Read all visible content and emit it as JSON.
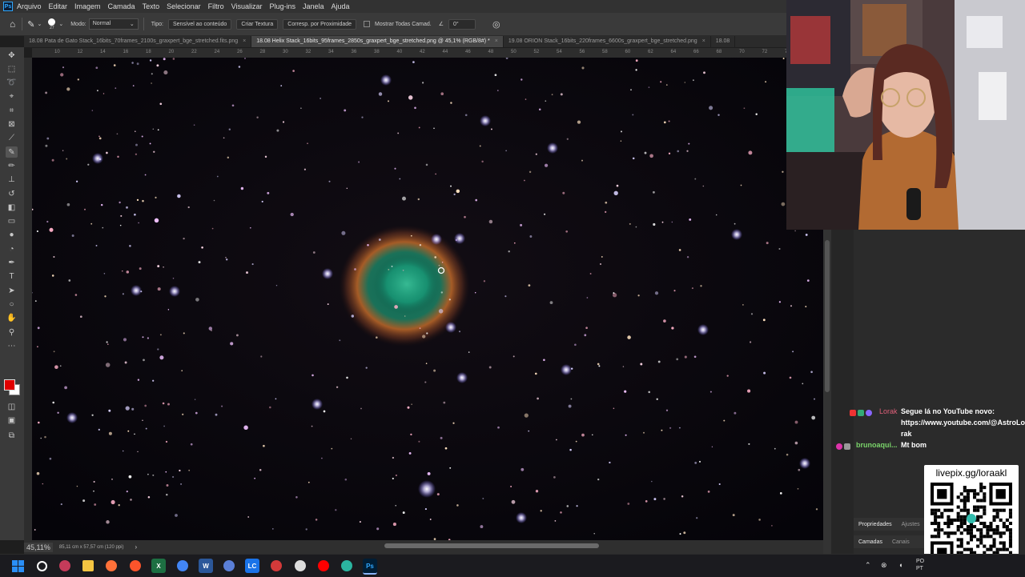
{
  "menubar": {
    "logo": "Ps",
    "items": [
      "Arquivo",
      "Editar",
      "Imagem",
      "Camada",
      "Texto",
      "Selecionar",
      "Filtro",
      "Visualizar",
      "Plug-ins",
      "Janela",
      "Ajuda"
    ]
  },
  "options": {
    "brush_size": "27",
    "mode_label": "Modo:",
    "mode_value": "Normal",
    "type_label": "Tipo:",
    "type_buttons": [
      "Sensível ao conteúdo",
      "Criar Textura",
      "Corresp. por Proximidade"
    ],
    "sample_all_label": "Mostrar Todas Camad.",
    "angle_value": "0°"
  },
  "tabs": [
    {
      "label": "18.08 Pata de Gato Stack_16bits_70frames_2100s_graxpert_bge_stretched.fits.png",
      "active": false
    },
    {
      "label": "18.08 Helix Stack_16bits_95frames_2850s_graxpert_bge_stretched.png @ 45,1% (RGB/8#) *",
      "active": true
    },
    {
      "label": "19.08 ORION Stack_16bits_220frames_6600s_graxpert_bge_stretched.png",
      "active": false
    },
    {
      "label": "18.08",
      "active": false
    }
  ],
  "ruler": {
    "ticks": [
      "10",
      "12",
      "14",
      "16",
      "18",
      "20",
      "22",
      "24",
      "26",
      "28",
      "30",
      "32",
      "34",
      "36",
      "38",
      "40",
      "42",
      "44",
      "46",
      "48",
      "50",
      "52",
      "54",
      "56",
      "58",
      "60",
      "62",
      "64",
      "66",
      "68",
      "70",
      "72",
      "74"
    ]
  },
  "status": {
    "zoom": "45,11%",
    "doc_info": "85,11 cm x 57,57 cm (120 ppi)",
    "arrow": "›"
  },
  "chat": [
    {
      "user": "Lorak",
      "message": "Segue lá no YouTube novo: https://www.youtube.com/@AstroLo rak",
      "user_color": "#e0607a"
    },
    {
      "user": "brunoaqui...",
      "message": "Mt bom",
      "user_color": "#7ad36a"
    }
  ],
  "panels": {
    "tabs1": [
      "Propriedades",
      "Ajustes"
    ],
    "tabs2": [
      "Camadas",
      "Canais"
    ]
  },
  "qr": {
    "label": "livepix.gg/loraakl"
  },
  "taskbar": {
    "apps": [
      {
        "name": "windows-start-icon",
        "glyph": "",
        "color": "#2a8ff7"
      },
      {
        "name": "search-icon",
        "glyph": "",
        "color": "#ffffff"
      },
      {
        "name": "task-view-icon",
        "glyph": "",
        "color": "#c43b5a"
      },
      {
        "name": "file-explorer-icon",
        "glyph": "",
        "color": "#f4c542"
      },
      {
        "name": "firefox-icon",
        "glyph": "",
        "color": "#ff7139"
      },
      {
        "name": "brave-icon",
        "glyph": "",
        "color": "#fb542b"
      },
      {
        "name": "excel-icon",
        "glyph": "X",
        "color": "#1d6f42"
      },
      {
        "name": "chrome-icon",
        "glyph": "",
        "color": "#4285f4"
      },
      {
        "name": "word-icon",
        "glyph": "W",
        "color": "#2b579a"
      },
      {
        "name": "app-diamond-icon",
        "glyph": "",
        "color": "#5a7fd8"
      },
      {
        "name": "lc-app-icon",
        "glyph": "LC",
        "color": "#1a73e8"
      },
      {
        "name": "recorder-app-icon",
        "glyph": "",
        "color": "#d33a3a"
      },
      {
        "name": "obs-icon",
        "glyph": "",
        "color": "#dddddd"
      },
      {
        "name": "youtube-app-icon",
        "glyph": "",
        "color": "#ff0000"
      },
      {
        "name": "globe-app-icon",
        "glyph": "",
        "color": "#2bb5a0"
      },
      {
        "name": "photoshop-icon",
        "glyph": "Ps",
        "color": "#31a8ff"
      }
    ],
    "tray_label": "PO PT"
  },
  "colors": {
    "foreground": "#e00000",
    "background": "#ffffff",
    "accent": "#31a8ff"
  }
}
